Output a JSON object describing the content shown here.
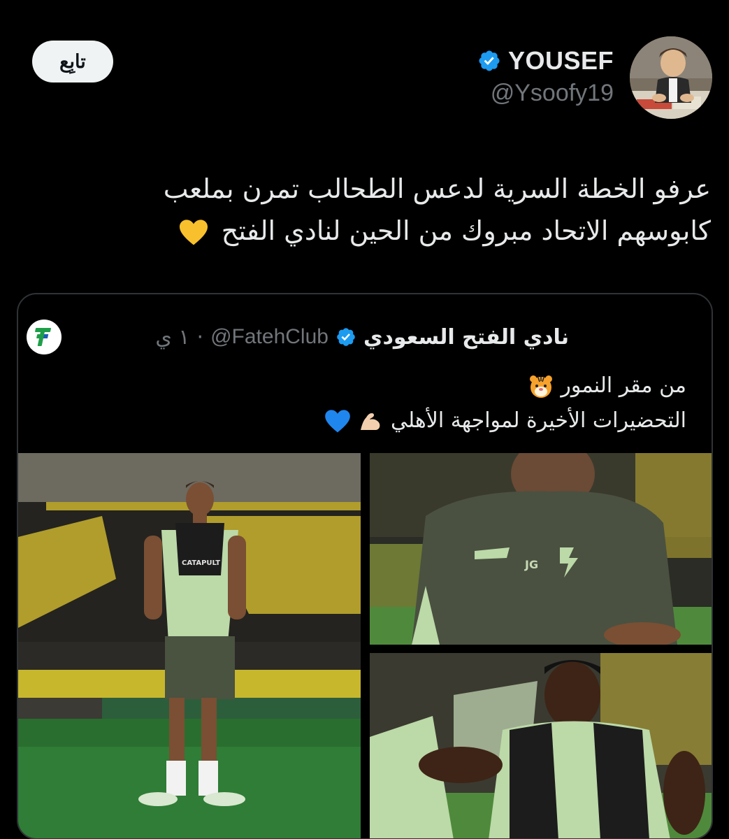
{
  "header": {
    "follow_label": "تابِع",
    "user_name": "YOUSEF",
    "user_handle": "@Ysoofy19",
    "verified": true,
    "verified_color": "#1d9bf0"
  },
  "tweet": {
    "text_line1": "عرفو الخطة السرية لدعس الطحالب تمرن بملعب",
    "text_line2": "كابوسهم الاتحاد مبروك من الحين لنادي الفتح",
    "emoji": "yellow-heart-icon"
  },
  "quote": {
    "name": "نادي الفتح السعودي",
    "handle": "@FatehClub",
    "separator": "·",
    "time": "١ ي",
    "line1": "من مقر النمور",
    "line1_emoji": "tiger-face-icon",
    "line2": "التحضيرات الأخيرة لمواجهة الأهلي",
    "line2_emojis": [
      "flexed-biceps-icon",
      "blue-heart-icon"
    ],
    "club_color": "#1f9e4a",
    "media": [
      {
        "name": "player-on-pitch-photo",
        "caption_text": "CATAPULT"
      },
      {
        "name": "coach-photo",
        "caption_text": "JG"
      },
      {
        "name": "players-training-photo"
      }
    ]
  }
}
